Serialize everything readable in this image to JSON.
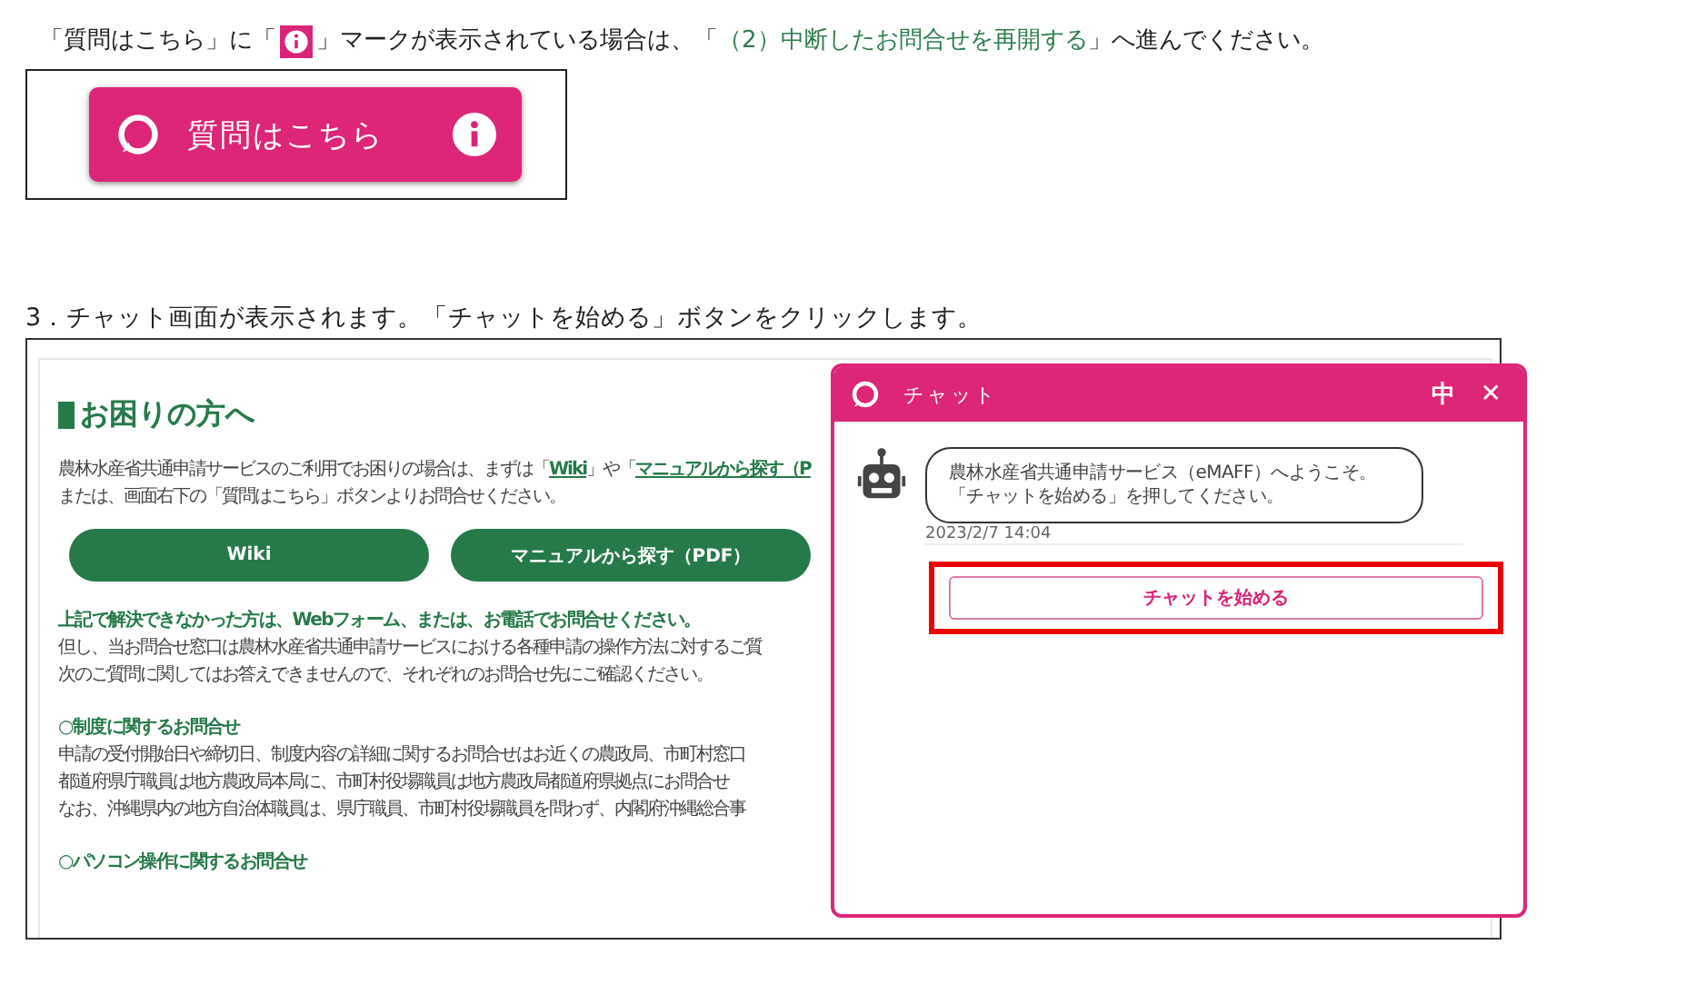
{
  "intro": {
    "before": "「質問はこちら」に「",
    "after": "」マークが表示されている場合は、「",
    "link": "（2）中断したお問合せを再開する",
    "end": "」へ進んでください。"
  },
  "example_button": {
    "label": "質問はこちら"
  },
  "step": "3．チャット画面が表示されます。「チャットを始める」ボタンをクリックします。",
  "page": {
    "heading": "お困りの方へ",
    "intro_lines": [
      [
        {
          "text": "農林水産省共通申請サービスのご利用でお困りの場合は、まずは「",
          "link": false
        },
        {
          "text": "Wiki",
          "link": true
        },
        {
          "text": "」や「",
          "link": false
        },
        {
          "text": "マニュアルから探す（P",
          "link": true
        }
      ],
      [
        {
          "text": "または、画面右下の「質問はこちら」ボタンよりお問合せください。",
          "link": false
        }
      ]
    ],
    "buttons": [
      "Wiki",
      "マニュアルから探す（PDF）"
    ],
    "sections": [
      {
        "title": "上記で解決できなかった方は、Webフォーム、または、お電話でお問合せください。",
        "lines": [
          "但し、当お問合せ窓口は農林水産省共通申請サービスにおける各種申請の操作方法に対するご質",
          "次のご質問に関してはお答えできませんので、それぞれのお問合せ先にご確認ください。"
        ]
      },
      {
        "title": "○制度に関するお問合せ",
        "lines": [
          "申請の受付開始日や締切日、制度内容の詳細に関するお問合せはお近くの農政局、市町村窓口",
          "都道府県庁職員は地方農政局本局に、市町村役場職員は地方農政局都道府県拠点にお問合せ",
          "なお、沖縄県内の地方自治体職員は、県庁職員、市町村役場職員を問わず、内閣府沖縄総合事"
        ]
      },
      {
        "title": "○パソコン操作に関するお問合せ"
      }
    ]
  },
  "chat": {
    "title": "チャット",
    "size": "中",
    "close": "✕",
    "message": [
      "農林水産省共通申請サービス（eMAFF）へようこそ。",
      "「チャットを始める」を押してください。"
    ],
    "time": "2023/2/7 14:04",
    "start_button": {
      "label": "チャットを始める",
      "highlighted": true
    }
  }
}
